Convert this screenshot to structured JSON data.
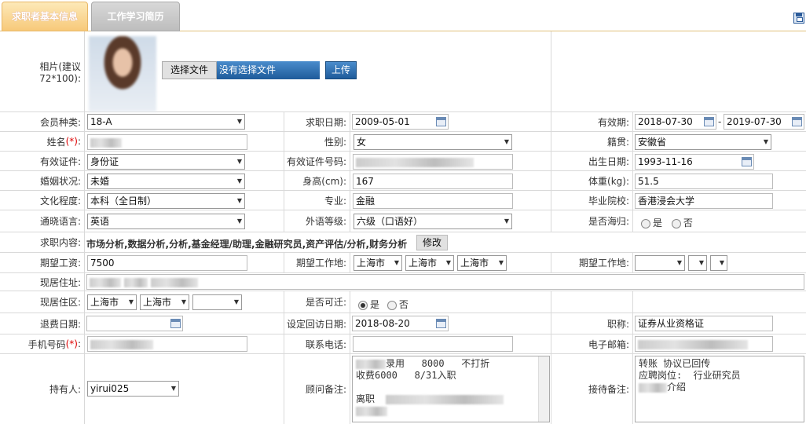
{
  "tabs": {
    "basic": "求职者基本信息",
    "resume": "工作学习简历"
  },
  "photo": {
    "label": "相片(建议72*100):",
    "choose": "选择文件",
    "no_file": "没有选择文件",
    "upload": "上传"
  },
  "r1": {
    "member_label": "会员种类:",
    "member": "18-A",
    "date_label": "求职日期:",
    "date": "2009-05-01",
    "valid_label": "有效期:",
    "valid_from": "2018-07-30",
    "dash": "-",
    "valid_to": "2019-07-30"
  },
  "r2": {
    "name_label": "姓名",
    "req": "(*)",
    "colon": ":",
    "gender_label": "性别:",
    "gender": "女",
    "native_label": "籍贯:",
    "native": "安徽省"
  },
  "r3": {
    "id_label": "有效证件:",
    "id": "身份证",
    "idno_label": "有效证件号码:",
    "birth_label": "出生日期:",
    "birth": "1993-11-16"
  },
  "r4": {
    "marital_label": "婚姻状况:",
    "marital": "未婚",
    "height_label": "身高(cm):",
    "height": "167",
    "weight_label": "体重(kg):",
    "weight": "51.5"
  },
  "r5": {
    "edu_label": "文化程度:",
    "edu": "本科（全日制）",
    "major_label": "专业:",
    "major": "金融",
    "school_label": "毕业院校:",
    "school": "香港浸会大学"
  },
  "r6": {
    "lang_label": "通晓语言:",
    "lang": "英语",
    "level_label": "外语等级:",
    "level": "六级（口语好）",
    "abroad_label": "是否海归:",
    "yes": "是",
    "no": "否"
  },
  "r7": {
    "content_label": "求职内容:",
    "content": "市场分析,数据分析,分析,基金经理/助理,金融研究员,资产评估/分析,财务分析",
    "edit": "修改"
  },
  "r8": {
    "salary_label": "期望工资:",
    "salary": "7500",
    "loc_label": "期望工作地:",
    "loc1": "上海市",
    "loc2": "上海市",
    "loc3": "上海市",
    "loc2_label": "期望工作地:"
  },
  "r9": {
    "addr_label": "现居住址:"
  },
  "r10": {
    "area_label": "现居住区:",
    "a1": "上海市",
    "a2": "上海市",
    "move_label": "是否可迁:",
    "yes": "是",
    "no": "否"
  },
  "r11": {
    "refund_label": "退费日期:",
    "visit_label": "设定回访日期:",
    "visit": "2018-08-20",
    "title_label": "职称:",
    "title": "证券从业资格证"
  },
  "r12": {
    "phone_label": "手机号码",
    "req": "(*)",
    "colon": ":",
    "tel_label": "联系电话:",
    "email_label": "电子邮箱:"
  },
  "r13": {
    "holder_label": "持有人:",
    "holder": "yirui025",
    "consult_label": "顾问备注:",
    "c_line1": "录用   8000   不打折",
    "c_line2": "收费6000   8/31入职",
    "c_line4": "离职",
    "recept_label": "接待备注:",
    "r_line1": "转账 协议已回传",
    "r_line2": "应聘岗位:  行业研究员",
    "r_line3": "介绍"
  },
  "colors": {
    "tab_active": "#f7c97a",
    "button_blue": "#1e5b9a",
    "required": "#dd0000"
  }
}
